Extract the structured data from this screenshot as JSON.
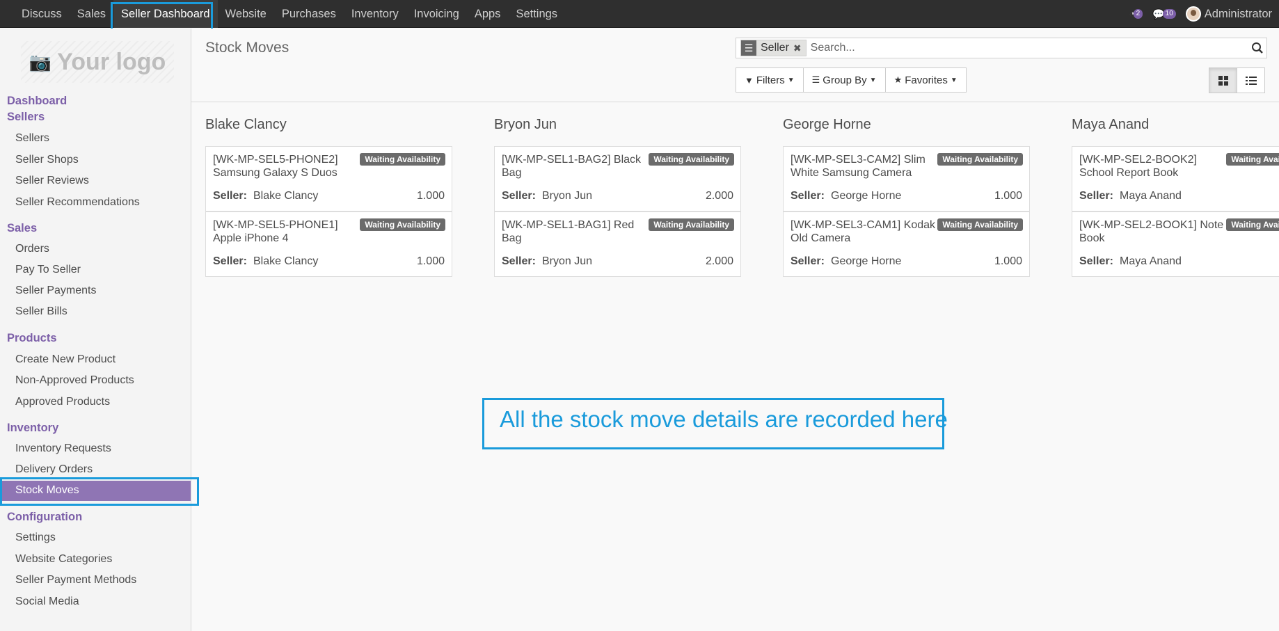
{
  "topnav": {
    "items": [
      "Discuss",
      "Sales",
      "Seller Dashboard",
      "Website",
      "Purchases",
      "Inventory",
      "Invoicing",
      "Apps",
      "Settings"
    ],
    "active": "Seller Dashboard",
    "activity_count": "2",
    "messages_count": "10",
    "user": "Administrator"
  },
  "sidebar": {
    "logo_text": "Your logo",
    "dashboard": "Dashboard",
    "sellers": {
      "title": "Sellers",
      "items": [
        "Sellers",
        "Seller Shops",
        "Seller Reviews",
        "Seller Recommendations"
      ]
    },
    "sales": {
      "title": "Sales",
      "items": [
        "Orders",
        "Pay To Seller",
        "Seller Payments",
        "Seller Bills"
      ]
    },
    "products": {
      "title": "Products",
      "items": [
        "Create New Product",
        "Non-Approved Products",
        "Approved Products"
      ]
    },
    "inventory": {
      "title": "Inventory",
      "items": [
        "Inventory Requests",
        "Delivery Orders",
        "Stock Moves"
      ]
    },
    "configuration": {
      "title": "Configuration",
      "items": [
        "Settings",
        "Website Categories",
        "Seller Payment Methods",
        "Social Media"
      ]
    }
  },
  "control": {
    "title": "Stock Moves",
    "facet": "Seller",
    "search_placeholder": "Search...",
    "filters": "Filters",
    "group_by": "Group By",
    "favorites": "Favorites"
  },
  "kanban": {
    "seller_label": "Seller:",
    "columns": [
      {
        "title": "Blake Clancy",
        "cards": [
          {
            "name": "[WK-MP-SEL5-PHONE2] Samsung Galaxy S Duos",
            "state": "Waiting Availability",
            "seller": "Blake Clancy",
            "qty": "1.000"
          },
          {
            "name": "[WK-MP-SEL5-PHONE1] Apple iPhone 4",
            "state": "Waiting Availability",
            "seller": "Blake Clancy",
            "qty": "1.000"
          }
        ]
      },
      {
        "title": "Bryon Jun",
        "cards": [
          {
            "name": "[WK-MP-SEL1-BAG2] Black Bag",
            "state": "Waiting Availability",
            "seller": "Bryon Jun",
            "qty": "2.000"
          },
          {
            "name": "[WK-MP-SEL1-BAG1] Red Bag",
            "state": "Waiting Availability",
            "seller": "Bryon Jun",
            "qty": "2.000"
          }
        ]
      },
      {
        "title": "George Horne",
        "cards": [
          {
            "name": "[WK-MP-SEL3-CAM2] Slim White Samsung Camera",
            "state": "Waiting Availability",
            "seller": "George Horne",
            "qty": "1.000"
          },
          {
            "name": "[WK-MP-SEL3-CAM1] Kodak Old Camera",
            "state": "Waiting Availability",
            "seller": "George Horne",
            "qty": "1.000"
          }
        ]
      },
      {
        "title": "Maya Anand",
        "cards": [
          {
            "name": "[WK-MP-SEL2-BOOK2] School Report Book",
            "state": "Waiting Availability",
            "seller": "Maya Anand",
            "qty": ""
          },
          {
            "name": "[WK-MP-SEL2-BOOK1] Note Book",
            "state": "Waiting Availability",
            "seller": "Maya Anand",
            "qty": ""
          }
        ]
      }
    ]
  },
  "callout": "All the stock move details are recorded here"
}
